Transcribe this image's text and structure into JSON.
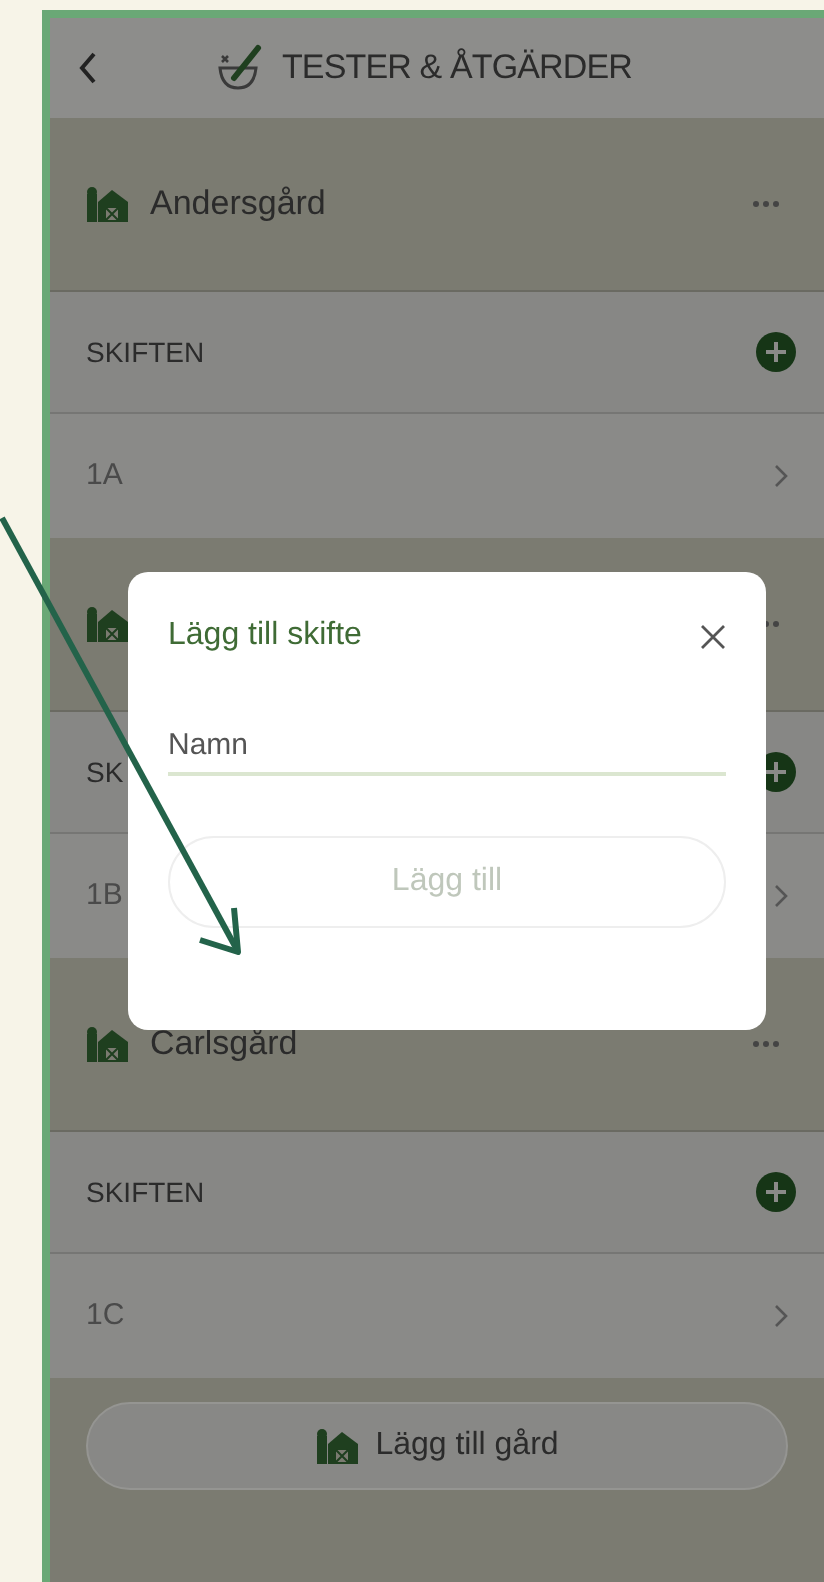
{
  "header": {
    "title": "TESTER & ÅTGÄRDER"
  },
  "farms": [
    {
      "name": "Andersgård",
      "section_label": "SKIFTEN",
      "fields": [
        "1A"
      ]
    },
    {
      "section_label": "SK",
      "fields": [
        "1B"
      ]
    },
    {
      "name": "Carlsgård",
      "section_label": "SKIFTEN",
      "fields": [
        "1C"
      ]
    }
  ],
  "add_farm_button": "Lägg till gård",
  "dialog": {
    "title": "Lägg till skifte",
    "name_field": {
      "placeholder": "Namn"
    },
    "submit_button": {
      "label": "Lägg till",
      "disabled": true
    }
  }
}
